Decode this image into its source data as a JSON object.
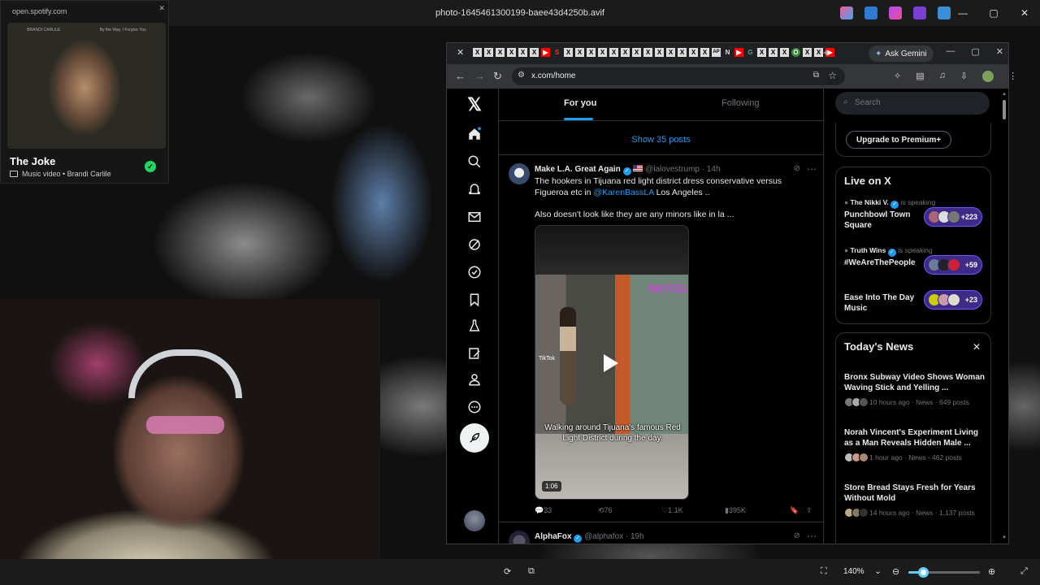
{
  "viewer": {
    "title": "photo-1645461300199-baee43d4250b.avif",
    "zoom": "140%",
    "zoom_fraction": 0.2,
    "controls": {
      "minimize": "—",
      "maximize": "▢",
      "close": "✕"
    }
  },
  "spotify": {
    "url": "open.spotify.com",
    "album_top": [
      "BRANDI CARLILE",
      "By the Way, I Forgive You"
    ],
    "title": "The Joke",
    "subtitle": "Music video • Brandi Carlile"
  },
  "chrome": {
    "tab_close": "✕",
    "tab_letters": [
      "X",
      "X",
      "X",
      "X",
      "X",
      "X",
      "▶",
      "S",
      "X",
      "X",
      "X",
      "X",
      "X",
      "X",
      "X",
      "X",
      "X",
      "X",
      "X",
      "X",
      "X",
      "AP",
      "N",
      "▶",
      "G",
      "X",
      "X",
      "X",
      "O",
      "X",
      "X",
      "▶"
    ],
    "new_tab": "+",
    "gemini_label": "Ask Gemini",
    "url": "x.com/home"
  },
  "x": {
    "tabs": {
      "for_you": "For you",
      "following": "Following"
    },
    "show_posts": "Show 35 posts",
    "tweet1": {
      "name": "Make L.A. Great Again",
      "handle": "@lalovestrump",
      "time": "· 14h",
      "text_a": "The hookers in Tijuana red light district dress conservative versus Figueroa etc in ",
      "mention": "@KarenBassLA",
      "text_b": " Los Angeles ..",
      "text_c": "Also doesn't look like they are any minors like in la ...",
      "video_caption": "Walking around Tijuana's famous Red Light District during the day.",
      "video_tiktok": "TikTok",
      "video_sign": "MOTEL",
      "duration": "1:06",
      "replies": "33",
      "reposts": "76",
      "likes": "1.1K",
      "views": "395K"
    },
    "tweet2": {
      "name": "AlphaFox",
      "handle": "@alphafox",
      "time": "· 19h"
    },
    "search_placeholder": "Search",
    "premium_button": "Upgrade to Premium+",
    "live_title": "Live on X",
    "live": [
      {
        "host": "The Nikki V.",
        "speaking": "is speaking",
        "title": "Punchbowl Town Square",
        "count": "+223"
      },
      {
        "host": "Truth Wins",
        "speaking": "is speaking",
        "title": "#WeAreThePeople",
        "count": "+59"
      },
      {
        "host": "",
        "speaking": "",
        "title": "Ease Into The Day Music",
        "count": "+23"
      }
    ],
    "news_title": "Today's News",
    "news": [
      {
        "headline": "Bronx Subway Video Shows Woman Waving Stick and Yelling ...",
        "meta": "10 hours ago · News · 649 posts"
      },
      {
        "headline": "Norah Vincent's Experiment Living as a Man Reveals Hidden Male ...",
        "meta": "1 hour ago · News · 462 posts"
      },
      {
        "headline": "Store Bread Stays Fresh for Years Without Mold",
        "meta": "14 hours ago · News · 1,137 posts"
      }
    ]
  },
  "colors": {
    "x_blue": "#1d9bf0",
    "spotify_green": "#1ed760",
    "live_purple": "#7856ff"
  }
}
